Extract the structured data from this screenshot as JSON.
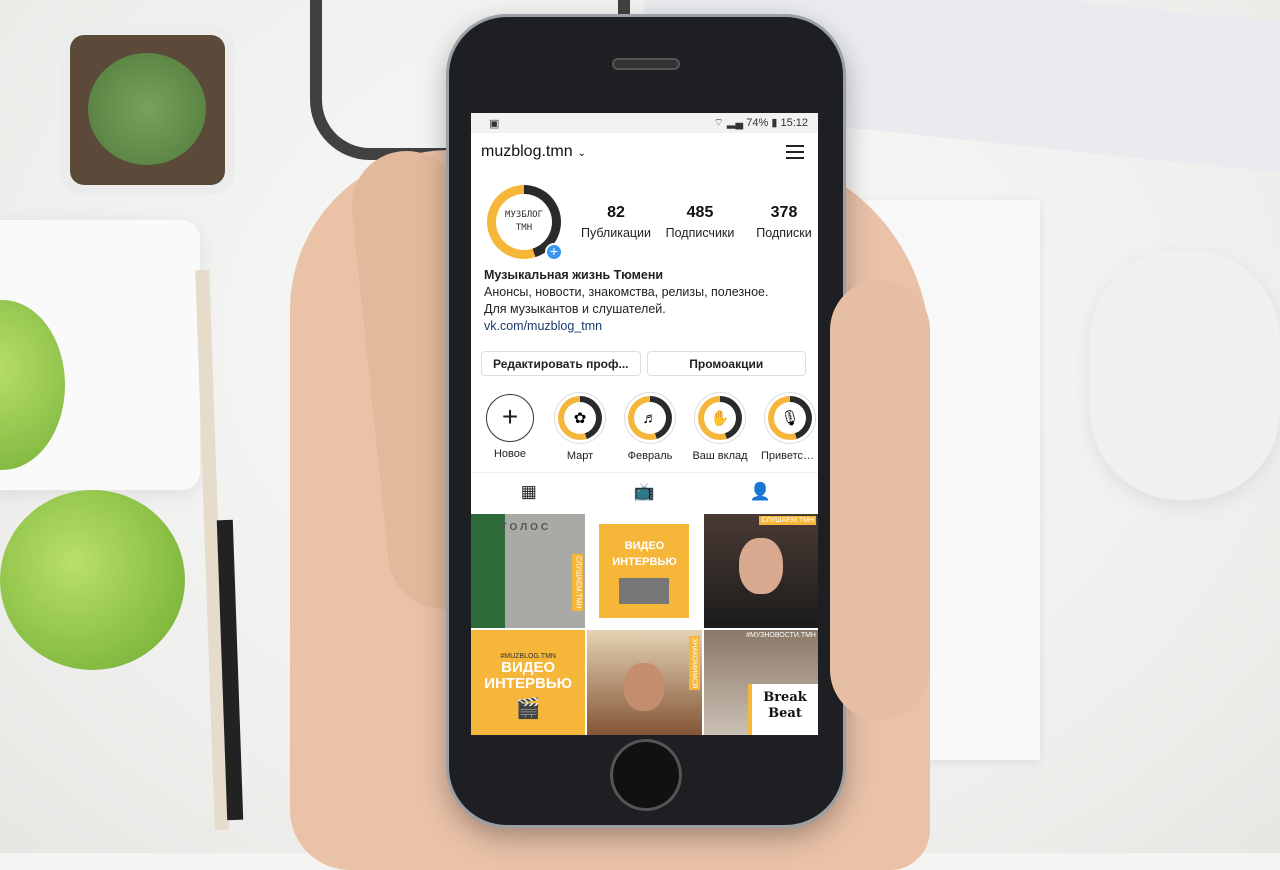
{
  "status_bar": {
    "battery": "74%",
    "time": "15:12"
  },
  "header": {
    "username": "muzblog.tmn"
  },
  "profile": {
    "avatar_text": [
      "МУЗБЛОГ",
      "ТМН"
    ],
    "stats": [
      {
        "value": "82",
        "label": "Публикации"
      },
      {
        "value": "485",
        "label": "Подписчики"
      },
      {
        "value": "378",
        "label": "Подписки"
      }
    ],
    "bio": {
      "name": "Музыкальная жизнь Тюмени",
      "line1": "Анонсы, новости, знакомства, релизы, полезное.",
      "line2": "Для музыкантов и слушателей.",
      "link": "vk.com/muzblog_tmn"
    }
  },
  "buttons": {
    "edit": "Редактировать проф...",
    "promo": "Промоакции"
  },
  "highlights": [
    {
      "label": "Новое",
      "icon": "plus"
    },
    {
      "label": "Март",
      "icon": "rose"
    },
    {
      "label": "Февраль",
      "icon": "piano"
    },
    {
      "label": "Ваш вклад",
      "icon": "hands"
    },
    {
      "label": "Приветств...",
      "icon": "microphone"
    }
  ],
  "tabs": [
    {
      "icon": "grid-icon"
    },
    {
      "icon": "igtv-icon"
    },
    {
      "icon": "tagged-icon"
    }
  ],
  "posts": [
    {
      "title": "ГОЛОС",
      "tag": "СЛУШАЕМ.ТМН"
    },
    {
      "title": "ВИДЕО ИНТЕРВЬЮ"
    },
    {
      "tag": "СЛУШАЕМ.ТМН"
    },
    {
      "title": "ВИДЕО ИНТЕРВЬЮ",
      "tag": "#MUZBLOG.TMN"
    },
    {
      "tag": "ЗНАКОМИМСЯ"
    },
    {
      "title": "Break Beat",
      "tag": "#МУЗНОВОСТИ.ТМН"
    }
  ],
  "colors": {
    "accent": "#f5b63a",
    "link": "#1a3a6b",
    "blue": "#3897f0"
  }
}
